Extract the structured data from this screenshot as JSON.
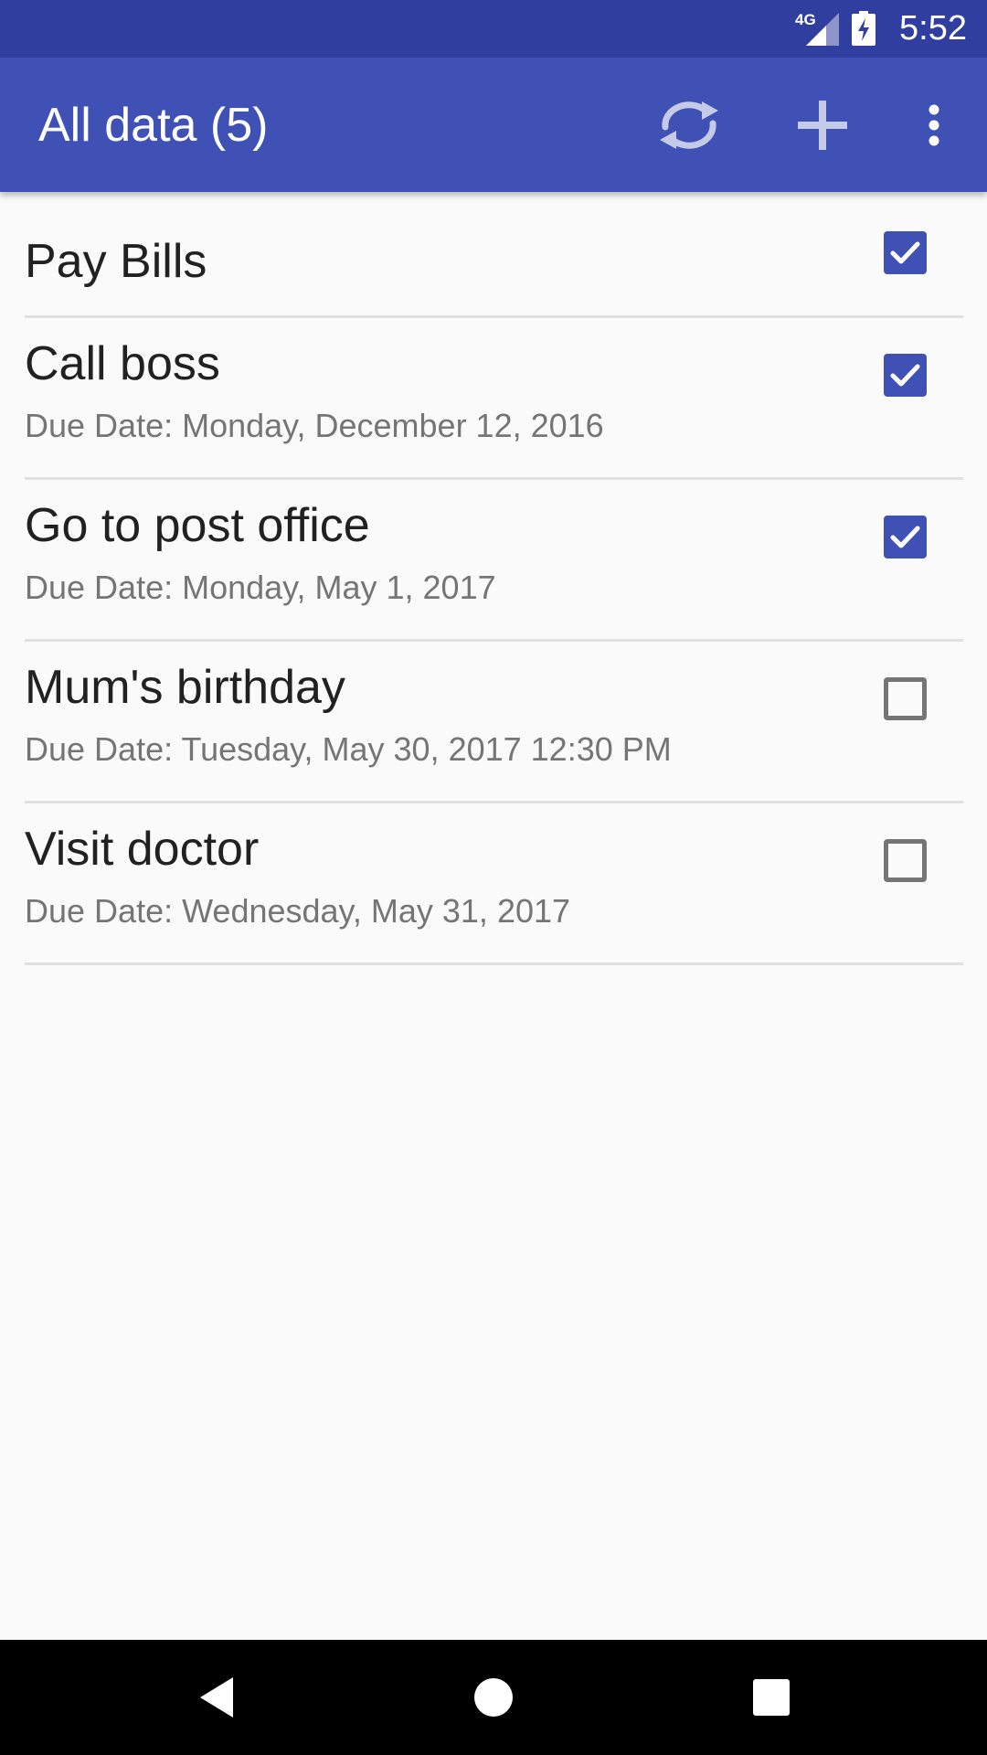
{
  "status_bar": {
    "network_label": "4G",
    "time": "5:52"
  },
  "app_bar": {
    "title": "All data (5)",
    "actions": [
      {
        "icon": "sync-icon"
      },
      {
        "icon": "add-icon"
      },
      {
        "icon": "more-vert-icon"
      }
    ]
  },
  "tasks": [
    {
      "title": "Pay Bills",
      "subtitle": "",
      "checked": true
    },
    {
      "title": "Call boss",
      "subtitle": "Due Date: Monday, December 12, 2016",
      "checked": true
    },
    {
      "title": "Go to post office",
      "subtitle": "Due Date: Monday, May 1, 2017",
      "checked": true
    },
    {
      "title": "Mum's birthday",
      "subtitle": "Due Date: Tuesday, May 30, 2017 12:30 PM",
      "checked": false
    },
    {
      "title": "Visit doctor",
      "subtitle": "Due Date: Wednesday, May 31, 2017",
      "checked": false
    }
  ],
  "colors": {
    "primary": "#3f51b5",
    "primary_dark": "#303f9f",
    "background": "#fafafa",
    "divider": "#e0e0e0"
  },
  "nav_bar": {
    "buttons": [
      {
        "icon": "back-icon"
      },
      {
        "icon": "home-icon"
      },
      {
        "icon": "recents-icon"
      }
    ]
  }
}
